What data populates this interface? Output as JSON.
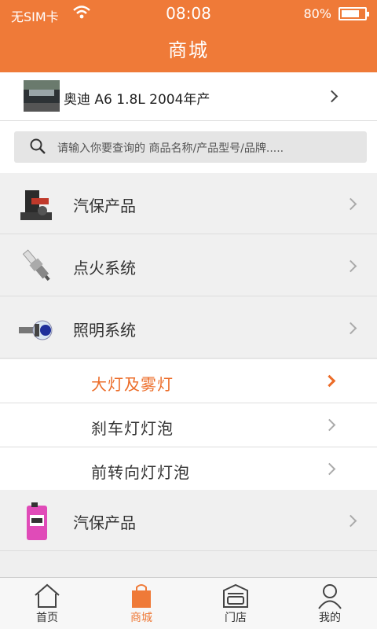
{
  "status": {
    "carrier": "无SIM卡",
    "time": "08:08",
    "battery": "80%",
    "battery_level": 0.8
  },
  "header": {
    "title": "商城"
  },
  "vehicle": {
    "label": "奥迪 A6 1.8L 2004年产"
  },
  "search": {
    "placeholder": "请输入你要查询的 商品名称/产品型号/品牌....."
  },
  "categories": [
    {
      "label": "汽保产品",
      "icon": "lift-equipment-icon"
    },
    {
      "label": "点火系统",
      "icon": "spark-plug-icon"
    },
    {
      "label": "照明系统",
      "icon": "headlight-bulb-icon"
    }
  ],
  "subcategories": [
    {
      "label": "大灯及雾灯",
      "active": true
    },
    {
      "label": "刹车灯灯泡",
      "active": false
    },
    {
      "label": "前转向灯灯泡",
      "active": false
    }
  ],
  "last_category": {
    "label": "汽保产品",
    "icon": "pink-fluid-bottle-icon"
  },
  "tabs": [
    {
      "label": "首页",
      "icon": "home-icon"
    },
    {
      "label": "商城",
      "icon": "shopping-bag-icon",
      "active": true
    },
    {
      "label": "门店",
      "icon": "garage-icon"
    },
    {
      "label": "我的",
      "icon": "user-icon"
    }
  ],
  "colors": {
    "accent": "#ef7a38",
    "active_text": "#ec6c28"
  }
}
